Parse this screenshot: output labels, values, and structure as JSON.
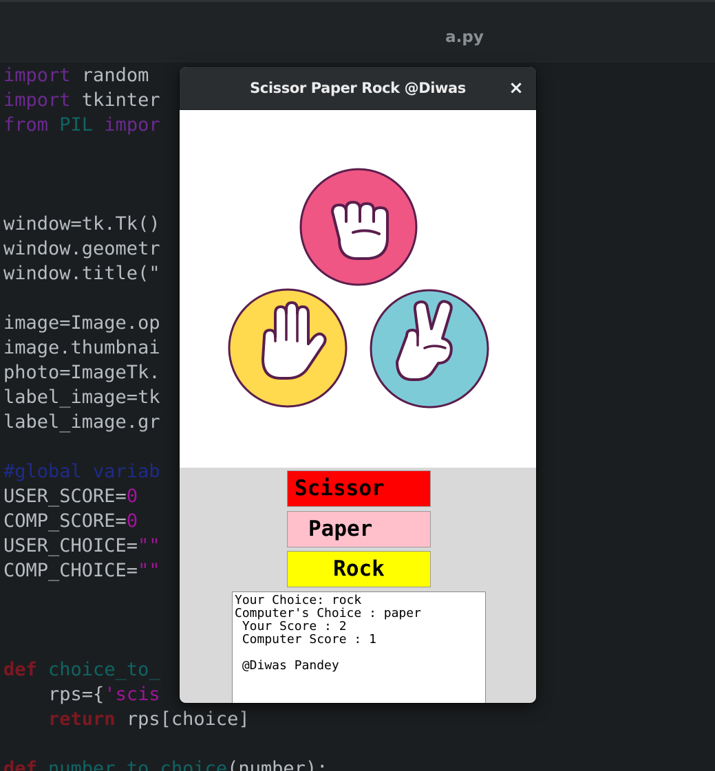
{
  "editor": {
    "file_tab": "a.py",
    "code_lines": [
      [
        {
          "t": "import",
          "c": "kw1"
        },
        {
          "t": " random",
          "c": "txt"
        }
      ],
      [
        {
          "t": "import",
          "c": "kw1"
        },
        {
          "t": " tkinter",
          "c": "txt"
        }
      ],
      [
        {
          "t": "from",
          "c": "kw1"
        },
        {
          "t": " PIL ",
          "c": "mod"
        },
        {
          "t": "impor",
          "c": "kw1"
        }
      ],
      [],
      [],
      [],
      [
        {
          "t": "window=tk.Tk()",
          "c": "txt"
        }
      ],
      [
        {
          "t": "window.geometr",
          "c": "txt"
        }
      ],
      [
        {
          "t": "window.title(\"",
          "c": "txt"
        }
      ],
      [],
      [
        {
          "t": "image=Image.op",
          "c": "txt"
        }
      ],
      [
        {
          "t": "image.thumbnai",
          "c": "txt"
        }
      ],
      [
        {
          "t": "photo=ImageTk.",
          "c": "txt"
        }
      ],
      [
        {
          "t": "label_image=tk",
          "c": "txt"
        }
      ],
      [
        {
          "t": "label_image.gr",
          "c": "txt"
        }
      ],
      [],
      [
        {
          "t": "#global variab",
          "c": "com"
        }
      ],
      [
        {
          "t": "USER_SCORE=",
          "c": "txt"
        },
        {
          "t": "0",
          "c": "num"
        }
      ],
      [
        {
          "t": "COMP_SCORE=",
          "c": "txt"
        },
        {
          "t": "0",
          "c": "num"
        }
      ],
      [
        {
          "t": "USER_CHOICE=",
          "c": "txt"
        },
        {
          "t": "\"\"",
          "c": "str"
        }
      ],
      [
        {
          "t": "COMP_CHOICE=",
          "c": "txt"
        },
        {
          "t": "\"\"",
          "c": "str"
        }
      ],
      [],
      [],
      [],
      [
        {
          "t": "def",
          "c": "kw2"
        },
        {
          "t": " choice_to_",
          "c": "mod"
        }
      ],
      [
        {
          "t": "    rps={",
          "c": "txt"
        },
        {
          "t": "'scis",
          "c": "str"
        }
      ],
      [
        {
          "t": "    ",
          "c": "txt"
        },
        {
          "t": "return",
          "c": "kw2"
        },
        {
          "t": " rps[choice]",
          "c": "txt"
        }
      ],
      [],
      [
        {
          "t": "def",
          "c": "kw2"
        },
        {
          "t": " number_to_choice",
          "c": "mod"
        },
        {
          "t": "(number):",
          "c": "txt"
        }
      ]
    ]
  },
  "dialog": {
    "title": "Scissor Paper Rock @Diwas",
    "close_glyph": "×",
    "image_icons": [
      "rock-fist-icon",
      "paper-hand-icon",
      "scissors-hand-icon"
    ],
    "buttons": {
      "scissor": "Scissor",
      "paper": "Paper",
      "rock": "Rock"
    },
    "result": {
      "your_choice": "Your Choice: rock",
      "computer_choice": "Computer's Choice : paper",
      "your_score": " Your Score : 2",
      "computer_score": " Computer Score : 1",
      "credit": " @Diwas Pandey"
    },
    "colors": {
      "scissor_button": "#ff0000",
      "paper_button": "#ffc0cb",
      "rock_button": "#ffff00",
      "rock_circle": "#ef5683",
      "paper_circle": "#ffd94e",
      "scissor_circle": "#7ecbd8"
    }
  }
}
